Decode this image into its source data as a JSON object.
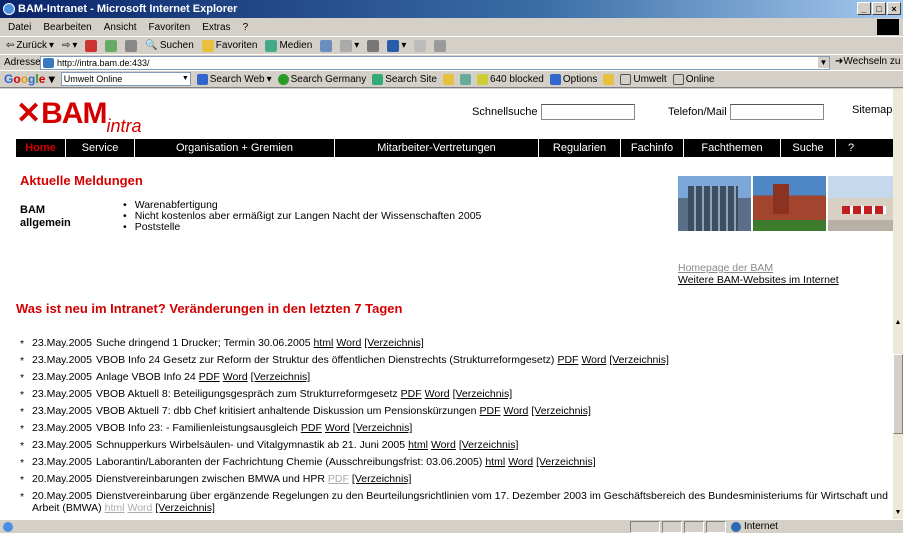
{
  "window": {
    "title": "BAM-Intranet - Microsoft Internet Explorer"
  },
  "menu": [
    "Datei",
    "Bearbeiten",
    "Ansicht",
    "Favoriten",
    "Extras",
    "?"
  ],
  "toolbar": {
    "back": "Zurück",
    "search": "Suchen",
    "favorites": "Favoriten",
    "media": "Medien"
  },
  "address": {
    "label": "Adresse",
    "url": "http://intra.bam.de:433/",
    "go": "Wechseln zu"
  },
  "google": {
    "logo": "Google",
    "select": "Umwelt Online",
    "search_web": "Search Web",
    "search_germany": "Search Germany",
    "search_site": "Search Site",
    "blocked": "640 blocked",
    "options": "Options",
    "umwelt": "Umwelt",
    "online": "Online"
  },
  "site": {
    "logo_bam": "BAM",
    "logo_intra": "intra",
    "schnellsuche": "Schnellsuche",
    "telefon": "Telefon/Mail",
    "sitemap": "Sitemap"
  },
  "nav": [
    "Home",
    "Service",
    "Organisation + Gremien",
    "Mitarbeiter-Vertretungen",
    "Regularien",
    "Fachinfo",
    "Fachthemen",
    "Suche",
    "?"
  ],
  "news": {
    "heading": "Aktuelle Meldungen",
    "category": "BAM allgemein",
    "items": [
      "Warenabfertigung",
      "Nicht kostenlos aber ermäßigt zur Langen Nacht der Wissenschaften 2005",
      "Poststelle"
    ]
  },
  "links": {
    "homepage": "Homepage der BAM",
    "more": "Weitere BAM-Websites im Internet"
  },
  "updates_heading": "Was ist neu im Intranet? Veränderungen in den letzten 7 Tagen",
  "updates": [
    {
      "date": "23.May.2005",
      "text": "Suche dringend 1 Drucker; Termin 30.06.2005",
      "links": [
        "html",
        "Word",
        "[Verzeichnis]"
      ]
    },
    {
      "date": "23.May.2005",
      "text": "VBOB Info 24 Gesetz zur Reform der Struktur des öffentlichen Dienstrechts (Strukturreformgesetz)",
      "links": [
        "PDF",
        "Word",
        "[Verzeichnis]"
      ]
    },
    {
      "date": "23.May.2005",
      "text": "Anlage VBOB Info 24",
      "links": [
        "PDF",
        "Word",
        "[Verzeichnis]"
      ]
    },
    {
      "date": "23.May.2005",
      "text": "VBOB Aktuell 8: Beteiligungsgespräch zum Strukturreformgesetz",
      "links": [
        "PDF",
        "Word",
        "[Verzeichnis]"
      ]
    },
    {
      "date": "23.May.2005",
      "text": "VBOB Aktuell 7: dbb Chef kritisiert anhaltende Diskussion um Pensionskürzungen",
      "links": [
        "PDF",
        "Word",
        "[Verzeichnis]"
      ]
    },
    {
      "date": "23.May.2005",
      "text": "VBOB Info 23: - Familienleistungsausgleich",
      "links": [
        "PDF",
        "Word",
        "[Verzeichnis]"
      ]
    },
    {
      "date": "23.May.2005",
      "text": "Schnupperkurs Wirbelsäulen- und Vitalgymnastik ab 21. Juni 2005",
      "links": [
        "html",
        "Word",
        "[Verzeichnis]"
      ]
    },
    {
      "date": "23.May.2005",
      "text": "Laborantin/Laboranten der Fachrichtung Chemie (Ausschreibungsfrist: 03.06.2005)",
      "links": [
        "html",
        "Word",
        "[Verzeichnis]"
      ]
    },
    {
      "date": "20.May.2005",
      "text": "Dienstvereinbarungen zwischen BMWA und HPR",
      "links": [
        "PDF",
        "[Verzeichnis]"
      ]
    },
    {
      "date": "20.May.2005",
      "text": "Dienstvereinbarung über ergänzende Regelungen zu den Beurteilungsrichtlinien vom 17. Dezember 2003 im Geschäftsbereich des Bundesministeriums für Wirtschaft und Arbeit (BMWA)",
      "links": [
        "html",
        "Word",
        "[Verzeichnis]"
      ]
    }
  ],
  "status": {
    "zone": "Internet"
  },
  "colors": {
    "brand_red": "#d40000",
    "nav_bg": "#000000"
  }
}
